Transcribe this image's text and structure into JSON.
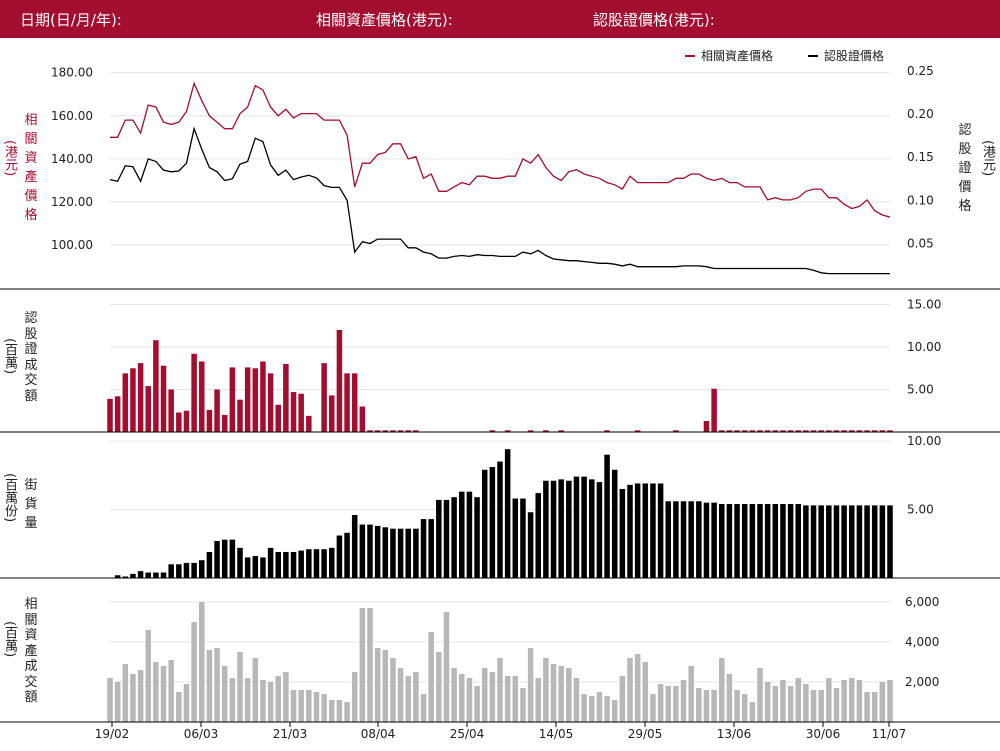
{
  "header": {
    "date_label": "日期(日/月/年):",
    "underlying_label": "相關資產價格(港元):",
    "warrant_label": "認股證價格(港元):"
  },
  "colors": {
    "header_bg": "#a30d2f",
    "underlying": "#a30d2f",
    "warrant": "#000000",
    "turnover_bar": "#b8b8b8"
  },
  "chart_data": [
    {
      "type": "line",
      "legend": [
        "相關資產價格",
        "認股證價格"
      ],
      "legend_position": "top-right",
      "ylabel_left": [
        "相",
        "關",
        "資",
        "產",
        "價",
        "格",
        "(港元)"
      ],
      "ylabel_right": [
        "認",
        "股",
        "證",
        "價",
        "格",
        "(港元)"
      ],
      "y_left_ticks": [
        "180.00",
        "160.00",
        "140.00",
        "120.00",
        "100.00"
      ],
      "y_left_range": [
        82,
        184
      ],
      "y_right_ticks": [
        "0.25",
        "0.20",
        "0.15",
        "0.10",
        "0.05"
      ],
      "y_right_range": [
        0.003,
        0.258
      ],
      "series": [
        {
          "name": "相關資產價格",
          "values": [
            150,
            150,
            158,
            158,
            152,
            165,
            164,
            157,
            156,
            157,
            162,
            175,
            167,
            160,
            157,
            154,
            154,
            161,
            164,
            174,
            172,
            164,
            160,
            163,
            159,
            161,
            161,
            161,
            158,
            158,
            158,
            151,
            127,
            138,
            138,
            142,
            143,
            147,
            147,
            140,
            141,
            131,
            133,
            125,
            125,
            127,
            129,
            128,
            132,
            132,
            131,
            131,
            132,
            132,
            140,
            138,
            142,
            136,
            132,
            130,
            134,
            135,
            133,
            132,
            131,
            129,
            128,
            126,
            132,
            129,
            129,
            129,
            129,
            129,
            131,
            131,
            133,
            133,
            131,
            130,
            131,
            129,
            129,
            127,
            127,
            127,
            121,
            122,
            121,
            121,
            122,
            125,
            126,
            126,
            122,
            122,
            119,
            117,
            118,
            121,
            116,
            114,
            113
          ]
        },
        {
          "name": "認股證價格",
          "values": [
            0.124,
            0.122,
            0.14,
            0.139,
            0.122,
            0.148,
            0.145,
            0.135,
            0.133,
            0.134,
            0.143,
            0.183,
            0.159,
            0.138,
            0.133,
            0.123,
            0.125,
            0.142,
            0.145,
            0.172,
            0.168,
            0.141,
            0.129,
            0.135,
            0.124,
            0.127,
            0.129,
            0.126,
            0.117,
            0.115,
            0.115,
            0.1,
            0.04,
            0.052,
            0.05,
            0.055,
            0.055,
            0.055,
            0.055,
            0.045,
            0.045,
            0.04,
            0.038,
            0.033,
            0.033,
            0.035,
            0.036,
            0.035,
            0.037,
            0.036,
            0.036,
            0.035,
            0.035,
            0.035,
            0.04,
            0.038,
            0.042,
            0.036,
            0.032,
            0.031,
            0.03,
            0.03,
            0.029,
            0.028,
            0.027,
            0.027,
            0.026,
            0.024,
            0.026,
            0.023,
            0.023,
            0.023,
            0.023,
            0.023,
            0.023,
            0.024,
            0.024,
            0.024,
            0.023,
            0.021,
            0.021,
            0.021,
            0.021,
            0.021,
            0.021,
            0.021,
            0.021,
            0.021,
            0.021,
            0.021,
            0.021,
            0.021,
            0.019,
            0.016,
            0.015,
            0.015,
            0.015,
            0.015,
            0.015,
            0.015,
            0.015,
            0.015,
            0.015
          ]
        }
      ]
    },
    {
      "type": "bar",
      "ylabel": [
        "認",
        "股",
        "證",
        "成",
        "交",
        "額",
        "(百萬)"
      ],
      "y_ticks": [
        "15.00",
        "10.00",
        "5.00"
      ],
      "y_range": [
        0,
        16
      ],
      "values": [
        3.9,
        4.2,
        6.9,
        7.5,
        8.1,
        5.4,
        10.8,
        7.8,
        5.0,
        2.3,
        2.5,
        9.2,
        8.3,
        2.6,
        5.0,
        2.0,
        7.6,
        3.8,
        7.6,
        7.5,
        8.3,
        6.9,
        3.2,
        8.0,
        4.7,
        4.5,
        1.9,
        0.0,
        8.1,
        4.3,
        12.0,
        6.9,
        6.9,
        3.0,
        0.2,
        0.2,
        0.2,
        0.2,
        0.2,
        0.2,
        0.2,
        0.0,
        0.0,
        0.0,
        0.0,
        0.0,
        0.0,
        0.0,
        0.0,
        0.0,
        0.2,
        0.0,
        0.2,
        0.0,
        0.0,
        0.2,
        0.0,
        0.2,
        0.0,
        0.2,
        0.0,
        0.0,
        0.0,
        0.0,
        0.0,
        0.2,
        0.0,
        0.0,
        0.0,
        0.2,
        0.0,
        0.0,
        0.0,
        0.0,
        0.2,
        0.0,
        0.0,
        0.0,
        1.3,
        5.1,
        0.2,
        0.2,
        0.2,
        0.2,
        0.2,
        0.2,
        0.2,
        0.2,
        0.2,
        0.2,
        0.2,
        0.2,
        0.2,
        0.2,
        0.2,
        0.2,
        0.2,
        0.2,
        0.2,
        0.2,
        0.2,
        0.2,
        0.2
      ]
    },
    {
      "type": "bar",
      "ylabel": [
        "街",
        "貨",
        "量",
        "(百萬份)"
      ],
      "y_ticks": [
        "10.00",
        "5.00"
      ],
      "y_range": [
        0,
        10
      ],
      "values": [
        0.0,
        0.2,
        0.1,
        0.3,
        0.5,
        0.4,
        0.4,
        0.4,
        1.0,
        1.0,
        1.1,
        1.1,
        1.3,
        1.9,
        2.7,
        2.8,
        2.8,
        2.2,
        1.5,
        1.6,
        1.5,
        2.2,
        1.9,
        1.9,
        1.9,
        2.0,
        2.1,
        2.1,
        2.1,
        2.2,
        3.1,
        3.3,
        4.6,
        3.9,
        3.9,
        3.8,
        3.7,
        3.6,
        3.6,
        3.6,
        3.6,
        4.3,
        4.3,
        5.7,
        5.7,
        5.9,
        6.3,
        6.3,
        5.9,
        7.9,
        8.1,
        8.5,
        9.4,
        5.8,
        5.8,
        4.8,
        6.2,
        7.1,
        7.1,
        7.2,
        7.1,
        7.4,
        7.4,
        7.2,
        7.0,
        9.0,
        7.9,
        6.5,
        6.8,
        6.9,
        6.9,
        6.9,
        6.9,
        5.6,
        5.6,
        5.6,
        5.6,
        5.6,
        5.5,
        5.5,
        5.4,
        5.4,
        5.4,
        5.4,
        5.4,
        5.4,
        5.4,
        5.4,
        5.4,
        5.4,
        5.4,
        5.3,
        5.3,
        5.3,
        5.3,
        5.3,
        5.3,
        5.3,
        5.3,
        5.3,
        5.3,
        5.3,
        5.3
      ]
    },
    {
      "type": "bar",
      "ylabel": [
        "相",
        "關",
        "資",
        "產",
        "成",
        "交",
        "額",
        "(百萬)"
      ],
      "y_ticks": [
        "6,000",
        "4,000",
        "2,000"
      ],
      "y_range": [
        0,
        6700
      ],
      "x_tick_labels": [
        "19/02",
        "06/03",
        "21/03",
        "08/04",
        "25/04",
        "14/05",
        "29/05",
        "13/06",
        "30/06",
        "11/07"
      ],
      "values": [
        2200,
        2000,
        2900,
        2400,
        2600,
        4600,
        3000,
        2800,
        3100,
        1500,
        1900,
        5000,
        6000,
        3600,
        3700,
        2800,
        2200,
        3500,
        2200,
        3200,
        2100,
        2000,
        2300,
        2500,
        1600,
        1600,
        1600,
        1500,
        1400,
        1100,
        1100,
        1000,
        2500,
        5700,
        5700,
        3700,
        3600,
        3200,
        2700,
        2300,
        2500,
        1400,
        4500,
        3500,
        5500,
        2700,
        2400,
        2200,
        1800,
        2700,
        2500,
        3200,
        2300,
        2300,
        1700,
        3700,
        2200,
        3200,
        2900,
        2800,
        2700,
        2200,
        1400,
        1300,
        1500,
        1300,
        1100,
        2300,
        3200,
        3400,
        3000,
        1400,
        1900,
        1800,
        1800,
        2100,
        2800,
        1700,
        1600,
        1600,
        3200,
        2400,
        1600,
        1400,
        1000,
        2700,
        2000,
        1800,
        2100,
        1800,
        2200,
        1900,
        1600,
        1600,
        2200,
        1700,
        2100,
        2200,
        2100,
        1500,
        1500,
        2000,
        2100
      ]
    }
  ]
}
